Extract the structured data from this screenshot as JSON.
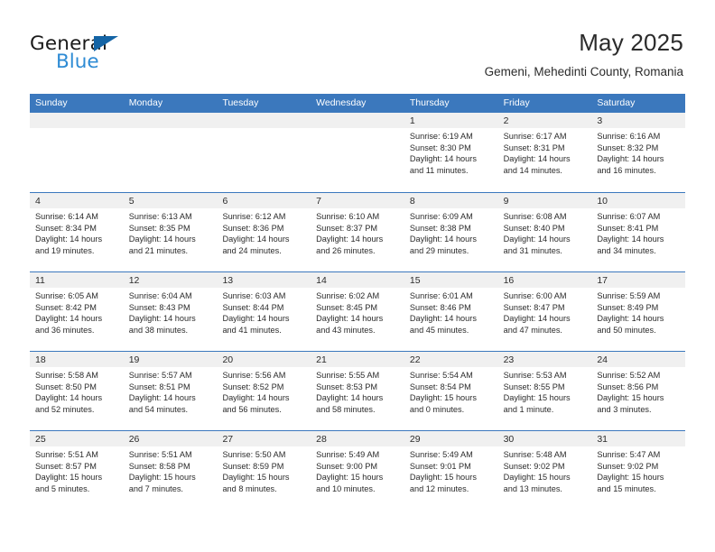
{
  "brand": {
    "name_top": "General",
    "name_bottom": "Blue",
    "accent_color": "#1464a5",
    "blue_text_color": "#2e8bd4"
  },
  "header": {
    "title": "May 2025",
    "subtitle": "Gemeni, Mehedinti County, Romania"
  },
  "theme": {
    "header_blue": "#3b78bd",
    "daynum_band": "#f0f0f0",
    "text": "#2b2b2b"
  },
  "weekdays": [
    "Sunday",
    "Monday",
    "Tuesday",
    "Wednesday",
    "Thursday",
    "Friday",
    "Saturday"
  ],
  "weeks": [
    [
      {
        "day": "",
        "sunrise": "",
        "sunset": "",
        "daylight1": "",
        "daylight2": ""
      },
      {
        "day": "",
        "sunrise": "",
        "sunset": "",
        "daylight1": "",
        "daylight2": ""
      },
      {
        "day": "",
        "sunrise": "",
        "sunset": "",
        "daylight1": "",
        "daylight2": ""
      },
      {
        "day": "",
        "sunrise": "",
        "sunset": "",
        "daylight1": "",
        "daylight2": ""
      },
      {
        "day": "1",
        "sunrise": "Sunrise: 6:19 AM",
        "sunset": "Sunset: 8:30 PM",
        "daylight1": "Daylight: 14 hours",
        "daylight2": "and 11 minutes."
      },
      {
        "day": "2",
        "sunrise": "Sunrise: 6:17 AM",
        "sunset": "Sunset: 8:31 PM",
        "daylight1": "Daylight: 14 hours",
        "daylight2": "and 14 minutes."
      },
      {
        "day": "3",
        "sunrise": "Sunrise: 6:16 AM",
        "sunset": "Sunset: 8:32 PM",
        "daylight1": "Daylight: 14 hours",
        "daylight2": "and 16 minutes."
      }
    ],
    [
      {
        "day": "4",
        "sunrise": "Sunrise: 6:14 AM",
        "sunset": "Sunset: 8:34 PM",
        "daylight1": "Daylight: 14 hours",
        "daylight2": "and 19 minutes."
      },
      {
        "day": "5",
        "sunrise": "Sunrise: 6:13 AM",
        "sunset": "Sunset: 8:35 PM",
        "daylight1": "Daylight: 14 hours",
        "daylight2": "and 21 minutes."
      },
      {
        "day": "6",
        "sunrise": "Sunrise: 6:12 AM",
        "sunset": "Sunset: 8:36 PM",
        "daylight1": "Daylight: 14 hours",
        "daylight2": "and 24 minutes."
      },
      {
        "day": "7",
        "sunrise": "Sunrise: 6:10 AM",
        "sunset": "Sunset: 8:37 PM",
        "daylight1": "Daylight: 14 hours",
        "daylight2": "and 26 minutes."
      },
      {
        "day": "8",
        "sunrise": "Sunrise: 6:09 AM",
        "sunset": "Sunset: 8:38 PM",
        "daylight1": "Daylight: 14 hours",
        "daylight2": "and 29 minutes."
      },
      {
        "day": "9",
        "sunrise": "Sunrise: 6:08 AM",
        "sunset": "Sunset: 8:40 PM",
        "daylight1": "Daylight: 14 hours",
        "daylight2": "and 31 minutes."
      },
      {
        "day": "10",
        "sunrise": "Sunrise: 6:07 AM",
        "sunset": "Sunset: 8:41 PM",
        "daylight1": "Daylight: 14 hours",
        "daylight2": "and 34 minutes."
      }
    ],
    [
      {
        "day": "11",
        "sunrise": "Sunrise: 6:05 AM",
        "sunset": "Sunset: 8:42 PM",
        "daylight1": "Daylight: 14 hours",
        "daylight2": "and 36 minutes."
      },
      {
        "day": "12",
        "sunrise": "Sunrise: 6:04 AM",
        "sunset": "Sunset: 8:43 PM",
        "daylight1": "Daylight: 14 hours",
        "daylight2": "and 38 minutes."
      },
      {
        "day": "13",
        "sunrise": "Sunrise: 6:03 AM",
        "sunset": "Sunset: 8:44 PM",
        "daylight1": "Daylight: 14 hours",
        "daylight2": "and 41 minutes."
      },
      {
        "day": "14",
        "sunrise": "Sunrise: 6:02 AM",
        "sunset": "Sunset: 8:45 PM",
        "daylight1": "Daylight: 14 hours",
        "daylight2": "and 43 minutes."
      },
      {
        "day": "15",
        "sunrise": "Sunrise: 6:01 AM",
        "sunset": "Sunset: 8:46 PM",
        "daylight1": "Daylight: 14 hours",
        "daylight2": "and 45 minutes."
      },
      {
        "day": "16",
        "sunrise": "Sunrise: 6:00 AM",
        "sunset": "Sunset: 8:47 PM",
        "daylight1": "Daylight: 14 hours",
        "daylight2": "and 47 minutes."
      },
      {
        "day": "17",
        "sunrise": "Sunrise: 5:59 AM",
        "sunset": "Sunset: 8:49 PM",
        "daylight1": "Daylight: 14 hours",
        "daylight2": "and 50 minutes."
      }
    ],
    [
      {
        "day": "18",
        "sunrise": "Sunrise: 5:58 AM",
        "sunset": "Sunset: 8:50 PM",
        "daylight1": "Daylight: 14 hours",
        "daylight2": "and 52 minutes."
      },
      {
        "day": "19",
        "sunrise": "Sunrise: 5:57 AM",
        "sunset": "Sunset: 8:51 PM",
        "daylight1": "Daylight: 14 hours",
        "daylight2": "and 54 minutes."
      },
      {
        "day": "20",
        "sunrise": "Sunrise: 5:56 AM",
        "sunset": "Sunset: 8:52 PM",
        "daylight1": "Daylight: 14 hours",
        "daylight2": "and 56 minutes."
      },
      {
        "day": "21",
        "sunrise": "Sunrise: 5:55 AM",
        "sunset": "Sunset: 8:53 PM",
        "daylight1": "Daylight: 14 hours",
        "daylight2": "and 58 minutes."
      },
      {
        "day": "22",
        "sunrise": "Sunrise: 5:54 AM",
        "sunset": "Sunset: 8:54 PM",
        "daylight1": "Daylight: 15 hours",
        "daylight2": "and 0 minutes."
      },
      {
        "day": "23",
        "sunrise": "Sunrise: 5:53 AM",
        "sunset": "Sunset: 8:55 PM",
        "daylight1": "Daylight: 15 hours",
        "daylight2": "and 1 minute."
      },
      {
        "day": "24",
        "sunrise": "Sunrise: 5:52 AM",
        "sunset": "Sunset: 8:56 PM",
        "daylight1": "Daylight: 15 hours",
        "daylight2": "and 3 minutes."
      }
    ],
    [
      {
        "day": "25",
        "sunrise": "Sunrise: 5:51 AM",
        "sunset": "Sunset: 8:57 PM",
        "daylight1": "Daylight: 15 hours",
        "daylight2": "and 5 minutes."
      },
      {
        "day": "26",
        "sunrise": "Sunrise: 5:51 AM",
        "sunset": "Sunset: 8:58 PM",
        "daylight1": "Daylight: 15 hours",
        "daylight2": "and 7 minutes."
      },
      {
        "day": "27",
        "sunrise": "Sunrise: 5:50 AM",
        "sunset": "Sunset: 8:59 PM",
        "daylight1": "Daylight: 15 hours",
        "daylight2": "and 8 minutes."
      },
      {
        "day": "28",
        "sunrise": "Sunrise: 5:49 AM",
        "sunset": "Sunset: 9:00 PM",
        "daylight1": "Daylight: 15 hours",
        "daylight2": "and 10 minutes."
      },
      {
        "day": "29",
        "sunrise": "Sunrise: 5:49 AM",
        "sunset": "Sunset: 9:01 PM",
        "daylight1": "Daylight: 15 hours",
        "daylight2": "and 12 minutes."
      },
      {
        "day": "30",
        "sunrise": "Sunrise: 5:48 AM",
        "sunset": "Sunset: 9:02 PM",
        "daylight1": "Daylight: 15 hours",
        "daylight2": "and 13 minutes."
      },
      {
        "day": "31",
        "sunrise": "Sunrise: 5:47 AM",
        "sunset": "Sunset: 9:02 PM",
        "daylight1": "Daylight: 15 hours",
        "daylight2": "and 15 minutes."
      }
    ]
  ]
}
